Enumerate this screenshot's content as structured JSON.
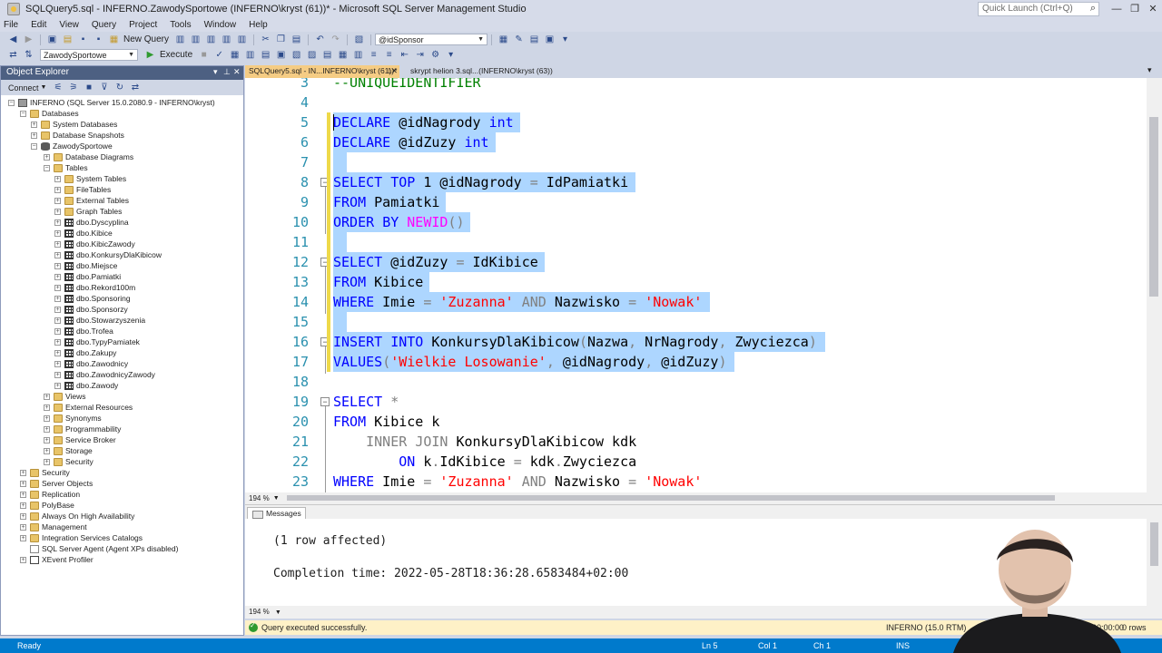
{
  "window": {
    "title": "SQLQuery5.sql - INFERNO.ZawodySportowe (INFERNO\\kryst (61))* - Microsoft SQL Server Management Studio",
    "quick_launch_placeholder": "Quick Launch (Ctrl+Q)",
    "controls": [
      "—",
      "❐",
      "✕"
    ]
  },
  "menu": [
    "File",
    "Edit",
    "View",
    "Query",
    "Project",
    "Tools",
    "Window",
    "Help"
  ],
  "toolbar1": {
    "new_query": "New Query",
    "param_combo": "@idSponsor"
  },
  "toolbar2": {
    "database": "ZawodySportowe",
    "execute": "Execute"
  },
  "object_explorer": {
    "title": "Object Explorer",
    "connect": "Connect",
    "nodes": [
      {
        "label": "INFERNO (SQL Server 15.0.2080.9 - INFERNO\\kryst)",
        "icon": "server-icon",
        "state": "-"
      },
      {
        "label": "Databases",
        "icon": "folder-icon",
        "state": "-"
      },
      {
        "label": "System Databases",
        "icon": "folder-icon",
        "state": "+"
      },
      {
        "label": "Database Snapshots",
        "icon": "folder-icon",
        "state": "+"
      },
      {
        "label": "ZawodySportowe",
        "icon": "database-icon",
        "state": "-"
      },
      {
        "label": "Database Diagrams",
        "icon": "folder-icon",
        "state": "+"
      },
      {
        "label": "Tables",
        "icon": "folder-icon",
        "state": "-"
      },
      {
        "label": "System Tables",
        "icon": "folder-icon",
        "state": "+"
      },
      {
        "label": "FileTables",
        "icon": "folder-icon",
        "state": "+"
      },
      {
        "label": "External Tables",
        "icon": "folder-icon",
        "state": "+"
      },
      {
        "label": "Graph Tables",
        "icon": "folder-icon",
        "state": "+"
      },
      {
        "label": "dbo.Dyscyplina",
        "icon": "table-icon",
        "state": "+"
      },
      {
        "label": "dbo.Kibice",
        "icon": "table-icon",
        "state": "+"
      },
      {
        "label": "dbo.KibicZawody",
        "icon": "table-icon",
        "state": "+"
      },
      {
        "label": "dbo.KonkursyDlaKibicow",
        "icon": "table-icon",
        "state": "+"
      },
      {
        "label": "dbo.Miejsce",
        "icon": "table-icon",
        "state": "+"
      },
      {
        "label": "dbo.Pamiatki",
        "icon": "table-icon",
        "state": "+"
      },
      {
        "label": "dbo.Rekord100m",
        "icon": "table-icon",
        "state": "+"
      },
      {
        "label": "dbo.Sponsoring",
        "icon": "table-icon",
        "state": "+"
      },
      {
        "label": "dbo.Sponsorzy",
        "icon": "table-icon",
        "state": "+"
      },
      {
        "label": "dbo.Stowarzyszenia",
        "icon": "table-icon",
        "state": "+"
      },
      {
        "label": "dbo.Trofea",
        "icon": "table-icon",
        "state": "+"
      },
      {
        "label": "dbo.TypyPamiatek",
        "icon": "table-icon",
        "state": "+"
      },
      {
        "label": "dbo.Zakupy",
        "icon": "table-icon",
        "state": "+"
      },
      {
        "label": "dbo.Zawodnicy",
        "icon": "table-icon",
        "state": "+"
      },
      {
        "label": "dbo.ZawodnicyZawody",
        "icon": "table-icon",
        "state": "+"
      },
      {
        "label": "dbo.Zawody",
        "icon": "table-icon",
        "state": "+"
      },
      {
        "label": "Views",
        "icon": "folder-icon",
        "state": "+"
      },
      {
        "label": "External Resources",
        "icon": "folder-icon",
        "state": "+"
      },
      {
        "label": "Synonyms",
        "icon": "folder-icon",
        "state": "+"
      },
      {
        "label": "Programmability",
        "icon": "folder-icon",
        "state": "+"
      },
      {
        "label": "Service Broker",
        "icon": "folder-icon",
        "state": "+"
      },
      {
        "label": "Storage",
        "icon": "folder-icon",
        "state": "+"
      },
      {
        "label": "Security",
        "icon": "folder-icon",
        "state": "+"
      },
      {
        "label": "Security",
        "icon": "folder-icon",
        "state": "+"
      },
      {
        "label": "Server Objects",
        "icon": "folder-icon",
        "state": "+"
      },
      {
        "label": "Replication",
        "icon": "folder-icon",
        "state": "+"
      },
      {
        "label": "PolyBase",
        "icon": "folder-icon",
        "state": "+"
      },
      {
        "label": "Always On High Availability",
        "icon": "folder-icon",
        "state": "+"
      },
      {
        "label": "Management",
        "icon": "folder-icon",
        "state": "+"
      },
      {
        "label": "Integration Services Catalogs",
        "icon": "folder-icon",
        "state": "+"
      },
      {
        "label": "SQL Server Agent (Agent XPs disabled)",
        "icon": "agent-icon",
        "state": ""
      },
      {
        "label": "XEvent Profiler",
        "icon": "xevent-icon",
        "state": "+"
      }
    ]
  },
  "tabs": [
    {
      "label": "SQLQuery5.sql - IN...INFERNO\\kryst (61))*",
      "active": true
    },
    {
      "label": "skrypt helion 3.sql...(INFERNO\\kryst (63))",
      "active": false
    }
  ],
  "editor": {
    "lines": [
      {
        "n": "3",
        "code": "--UNIQUEIDENTIFIER"
      },
      {
        "n": "4",
        "code": ""
      },
      {
        "n": "5",
        "code": "DECLARE @idNagrody int"
      },
      {
        "n": "6",
        "code": "DECLARE @idZuzy int"
      },
      {
        "n": "7",
        "code": ""
      },
      {
        "n": "8",
        "code": "SELECT TOP 1 @idNagrody = IdPamiatki"
      },
      {
        "n": "9",
        "code": "FROM Pamiatki"
      },
      {
        "n": "10",
        "code": "ORDER BY NEWID()"
      },
      {
        "n": "11",
        "code": ""
      },
      {
        "n": "12",
        "code": "SELECT @idZuzy = IdKibice"
      },
      {
        "n": "13",
        "code": "FROM Kibice"
      },
      {
        "n": "14",
        "code": "WHERE Imie = 'Zuzanna' AND Nazwisko = 'Nowak'"
      },
      {
        "n": "15",
        "code": ""
      },
      {
        "n": "16",
        "code": "INSERT INTO KonkursyDlaKibicow(Nazwa, NrNagrody, Zwyciezca)"
      },
      {
        "n": "17",
        "code": "VALUES('Wielkie Losowanie', @idNagrody, @idZuzy)"
      },
      {
        "n": "18",
        "code": ""
      },
      {
        "n": "19",
        "code": "SELECT *"
      },
      {
        "n": "20",
        "code": "FROM Kibice k"
      },
      {
        "n": "21",
        "code": "    INNER JOIN KonkursyDlaKibicow kdk"
      },
      {
        "n": "22",
        "code": "        ON k.IdKibice = kdk.Zwyciezca"
      },
      {
        "n": "23",
        "code": "WHERE Imie = 'Zuzanna' AND Nazwisko = 'Nowak'"
      }
    ],
    "zoom": "194 %"
  },
  "results": {
    "tab": "Messages",
    "line1": "(1 row affected)",
    "line2": "Completion time: 2022-05-28T18:36:28.6583484+02:00",
    "zoom": "194 %"
  },
  "query_status": {
    "message": "Query executed successfully.",
    "server": "INFERNO (15.0 RTM)",
    "time": "00:00:00",
    "rows": "0 rows"
  },
  "statusbar": {
    "ready": "Ready",
    "ln": "Ln 5",
    "col": "Col 1",
    "ch": "Ch 1",
    "ins": "INS"
  },
  "colors": {
    "keyword": "#0000ff",
    "string": "#ff0000",
    "function": "#ff00ff",
    "operator": "#808080",
    "comment": "#008000",
    "selection": "#add6ff",
    "statusbar": "#007acc",
    "active_tab": "#f5cc84"
  }
}
